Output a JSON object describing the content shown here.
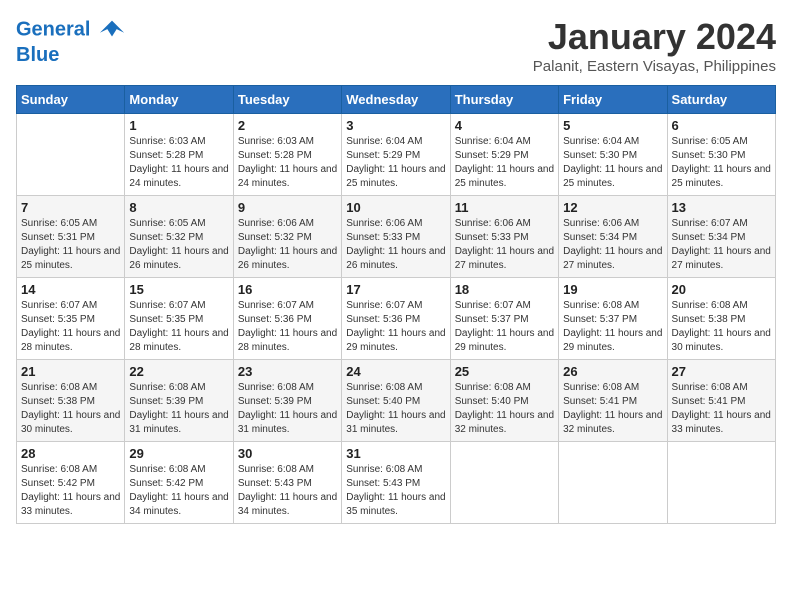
{
  "header": {
    "logo_line1": "General",
    "logo_line2": "Blue",
    "month": "January 2024",
    "location": "Palanit, Eastern Visayas, Philippines"
  },
  "days_of_week": [
    "Sunday",
    "Monday",
    "Tuesday",
    "Wednesday",
    "Thursday",
    "Friday",
    "Saturday"
  ],
  "weeks": [
    [
      {
        "day": "",
        "sunrise": "",
        "sunset": "",
        "daylight": ""
      },
      {
        "day": "1",
        "sunrise": "Sunrise: 6:03 AM",
        "sunset": "Sunset: 5:28 PM",
        "daylight": "Daylight: 11 hours and 24 minutes."
      },
      {
        "day": "2",
        "sunrise": "Sunrise: 6:03 AM",
        "sunset": "Sunset: 5:28 PM",
        "daylight": "Daylight: 11 hours and 24 minutes."
      },
      {
        "day": "3",
        "sunrise": "Sunrise: 6:04 AM",
        "sunset": "Sunset: 5:29 PM",
        "daylight": "Daylight: 11 hours and 25 minutes."
      },
      {
        "day": "4",
        "sunrise": "Sunrise: 6:04 AM",
        "sunset": "Sunset: 5:29 PM",
        "daylight": "Daylight: 11 hours and 25 minutes."
      },
      {
        "day": "5",
        "sunrise": "Sunrise: 6:04 AM",
        "sunset": "Sunset: 5:30 PM",
        "daylight": "Daylight: 11 hours and 25 minutes."
      },
      {
        "day": "6",
        "sunrise": "Sunrise: 6:05 AM",
        "sunset": "Sunset: 5:30 PM",
        "daylight": "Daylight: 11 hours and 25 minutes."
      }
    ],
    [
      {
        "day": "7",
        "sunrise": "Sunrise: 6:05 AM",
        "sunset": "Sunset: 5:31 PM",
        "daylight": "Daylight: 11 hours and 25 minutes."
      },
      {
        "day": "8",
        "sunrise": "Sunrise: 6:05 AM",
        "sunset": "Sunset: 5:32 PM",
        "daylight": "Daylight: 11 hours and 26 minutes."
      },
      {
        "day": "9",
        "sunrise": "Sunrise: 6:06 AM",
        "sunset": "Sunset: 5:32 PM",
        "daylight": "Daylight: 11 hours and 26 minutes."
      },
      {
        "day": "10",
        "sunrise": "Sunrise: 6:06 AM",
        "sunset": "Sunset: 5:33 PM",
        "daylight": "Daylight: 11 hours and 26 minutes."
      },
      {
        "day": "11",
        "sunrise": "Sunrise: 6:06 AM",
        "sunset": "Sunset: 5:33 PM",
        "daylight": "Daylight: 11 hours and 27 minutes."
      },
      {
        "day": "12",
        "sunrise": "Sunrise: 6:06 AM",
        "sunset": "Sunset: 5:34 PM",
        "daylight": "Daylight: 11 hours and 27 minutes."
      },
      {
        "day": "13",
        "sunrise": "Sunrise: 6:07 AM",
        "sunset": "Sunset: 5:34 PM",
        "daylight": "Daylight: 11 hours and 27 minutes."
      }
    ],
    [
      {
        "day": "14",
        "sunrise": "Sunrise: 6:07 AM",
        "sunset": "Sunset: 5:35 PM",
        "daylight": "Daylight: 11 hours and 28 minutes."
      },
      {
        "day": "15",
        "sunrise": "Sunrise: 6:07 AM",
        "sunset": "Sunset: 5:35 PM",
        "daylight": "Daylight: 11 hours and 28 minutes."
      },
      {
        "day": "16",
        "sunrise": "Sunrise: 6:07 AM",
        "sunset": "Sunset: 5:36 PM",
        "daylight": "Daylight: 11 hours and 28 minutes."
      },
      {
        "day": "17",
        "sunrise": "Sunrise: 6:07 AM",
        "sunset": "Sunset: 5:36 PM",
        "daylight": "Daylight: 11 hours and 29 minutes."
      },
      {
        "day": "18",
        "sunrise": "Sunrise: 6:07 AM",
        "sunset": "Sunset: 5:37 PM",
        "daylight": "Daylight: 11 hours and 29 minutes."
      },
      {
        "day": "19",
        "sunrise": "Sunrise: 6:08 AM",
        "sunset": "Sunset: 5:37 PM",
        "daylight": "Daylight: 11 hours and 29 minutes."
      },
      {
        "day": "20",
        "sunrise": "Sunrise: 6:08 AM",
        "sunset": "Sunset: 5:38 PM",
        "daylight": "Daylight: 11 hours and 30 minutes."
      }
    ],
    [
      {
        "day": "21",
        "sunrise": "Sunrise: 6:08 AM",
        "sunset": "Sunset: 5:38 PM",
        "daylight": "Daylight: 11 hours and 30 minutes."
      },
      {
        "day": "22",
        "sunrise": "Sunrise: 6:08 AM",
        "sunset": "Sunset: 5:39 PM",
        "daylight": "Daylight: 11 hours and 31 minutes."
      },
      {
        "day": "23",
        "sunrise": "Sunrise: 6:08 AM",
        "sunset": "Sunset: 5:39 PM",
        "daylight": "Daylight: 11 hours and 31 minutes."
      },
      {
        "day": "24",
        "sunrise": "Sunrise: 6:08 AM",
        "sunset": "Sunset: 5:40 PM",
        "daylight": "Daylight: 11 hours and 31 minutes."
      },
      {
        "day": "25",
        "sunrise": "Sunrise: 6:08 AM",
        "sunset": "Sunset: 5:40 PM",
        "daylight": "Daylight: 11 hours and 32 minutes."
      },
      {
        "day": "26",
        "sunrise": "Sunrise: 6:08 AM",
        "sunset": "Sunset: 5:41 PM",
        "daylight": "Daylight: 11 hours and 32 minutes."
      },
      {
        "day": "27",
        "sunrise": "Sunrise: 6:08 AM",
        "sunset": "Sunset: 5:41 PM",
        "daylight": "Daylight: 11 hours and 33 minutes."
      }
    ],
    [
      {
        "day": "28",
        "sunrise": "Sunrise: 6:08 AM",
        "sunset": "Sunset: 5:42 PM",
        "daylight": "Daylight: 11 hours and 33 minutes."
      },
      {
        "day": "29",
        "sunrise": "Sunrise: 6:08 AM",
        "sunset": "Sunset: 5:42 PM",
        "daylight": "Daylight: 11 hours and 34 minutes."
      },
      {
        "day": "30",
        "sunrise": "Sunrise: 6:08 AM",
        "sunset": "Sunset: 5:43 PM",
        "daylight": "Daylight: 11 hours and 34 minutes."
      },
      {
        "day": "31",
        "sunrise": "Sunrise: 6:08 AM",
        "sunset": "Sunset: 5:43 PM",
        "daylight": "Daylight: 11 hours and 35 minutes."
      },
      {
        "day": "",
        "sunrise": "",
        "sunset": "",
        "daylight": ""
      },
      {
        "day": "",
        "sunrise": "",
        "sunset": "",
        "daylight": ""
      },
      {
        "day": "",
        "sunrise": "",
        "sunset": "",
        "daylight": ""
      }
    ]
  ]
}
